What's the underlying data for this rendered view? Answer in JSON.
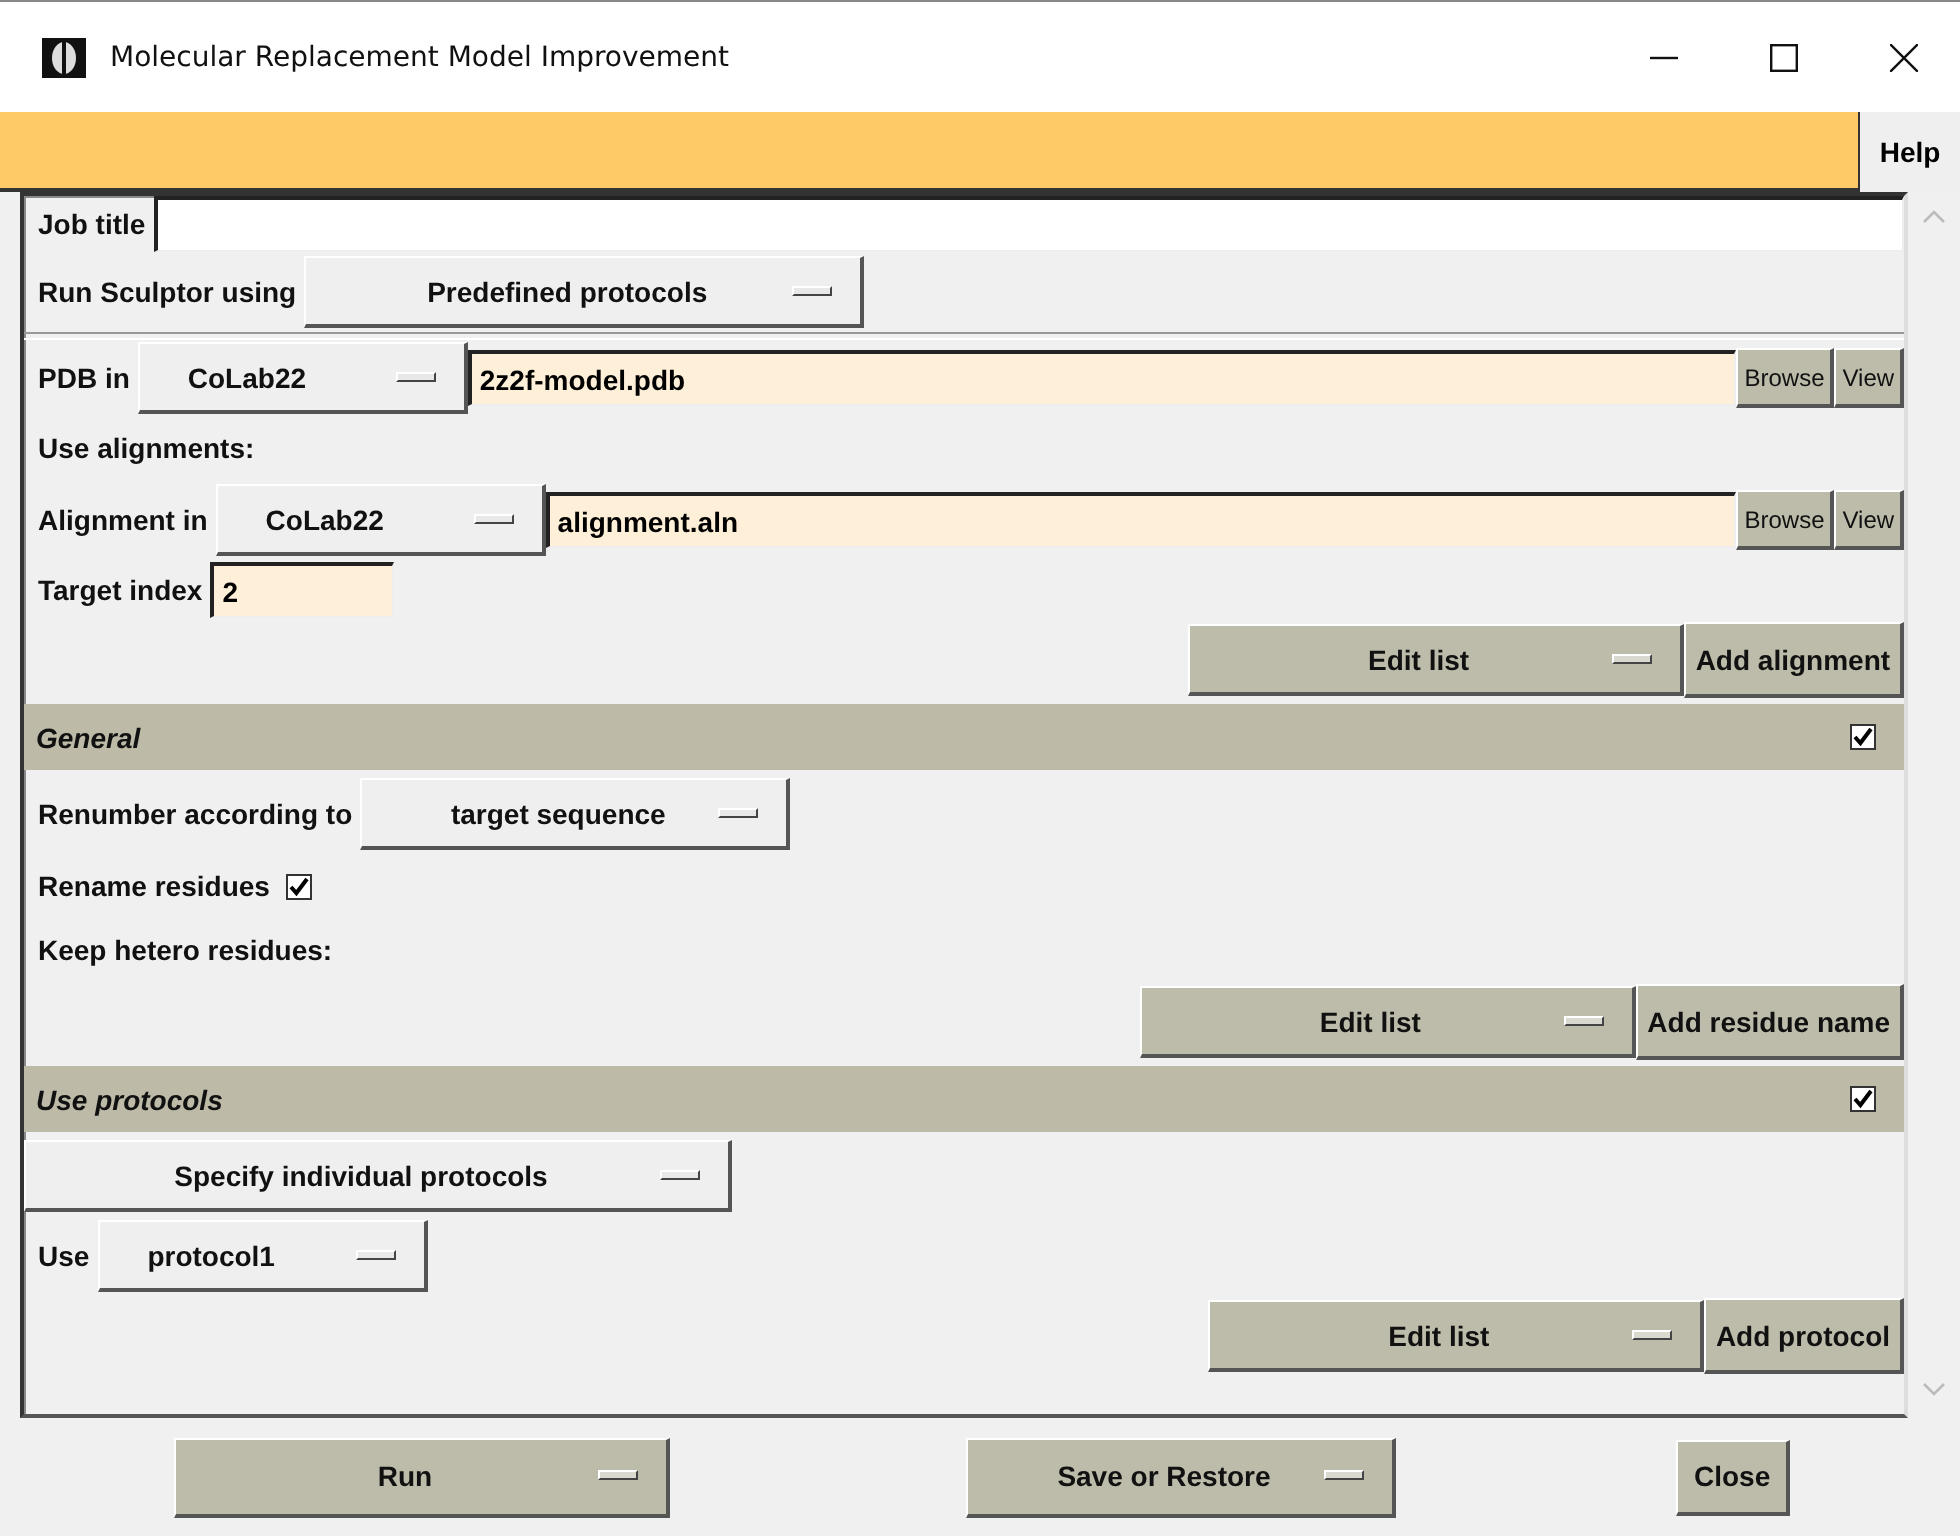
{
  "window": {
    "title": "Molecular Replacement Model Improvement"
  },
  "menu_bar": {
    "items": [
      "Help"
    ]
  },
  "job": {
    "label": "Job title"
  },
  "run_using": {
    "label": "Run Sculptor using",
    "value": "Predefined protocols"
  },
  "pdb_in": {
    "label": "PDB in",
    "project": "CoLab22",
    "file": "2z2f-model.pdb",
    "browse": "Browse",
    "view": "View"
  },
  "alignments": {
    "label": "Use alignments:",
    "alignment_label": "Alignment in",
    "project": "CoLab22",
    "file": "alignment.aln",
    "browse": "Browse",
    "view": "View",
    "target_label": "Target index",
    "target_value": "2",
    "edit_list": "Edit list",
    "add": "Add alignment"
  },
  "general": {
    "title": "General",
    "checked": true,
    "renumber_label": "Renumber according to",
    "renumber_value": "target sequence",
    "rename_label": "Rename residues",
    "rename_checked": true,
    "hetero_label": "Keep hetero residues:",
    "edit_list": "Edit list",
    "add": "Add residue name"
  },
  "protocols": {
    "title": "Use protocols",
    "checked": true,
    "mode": "Specify individual protocols",
    "use_label": "Use",
    "use_value": "protocol1",
    "edit_list": "Edit list",
    "add": "Add protocol"
  },
  "footer": {
    "run": "Run",
    "save": "Save or Restore",
    "close": "Close"
  }
}
